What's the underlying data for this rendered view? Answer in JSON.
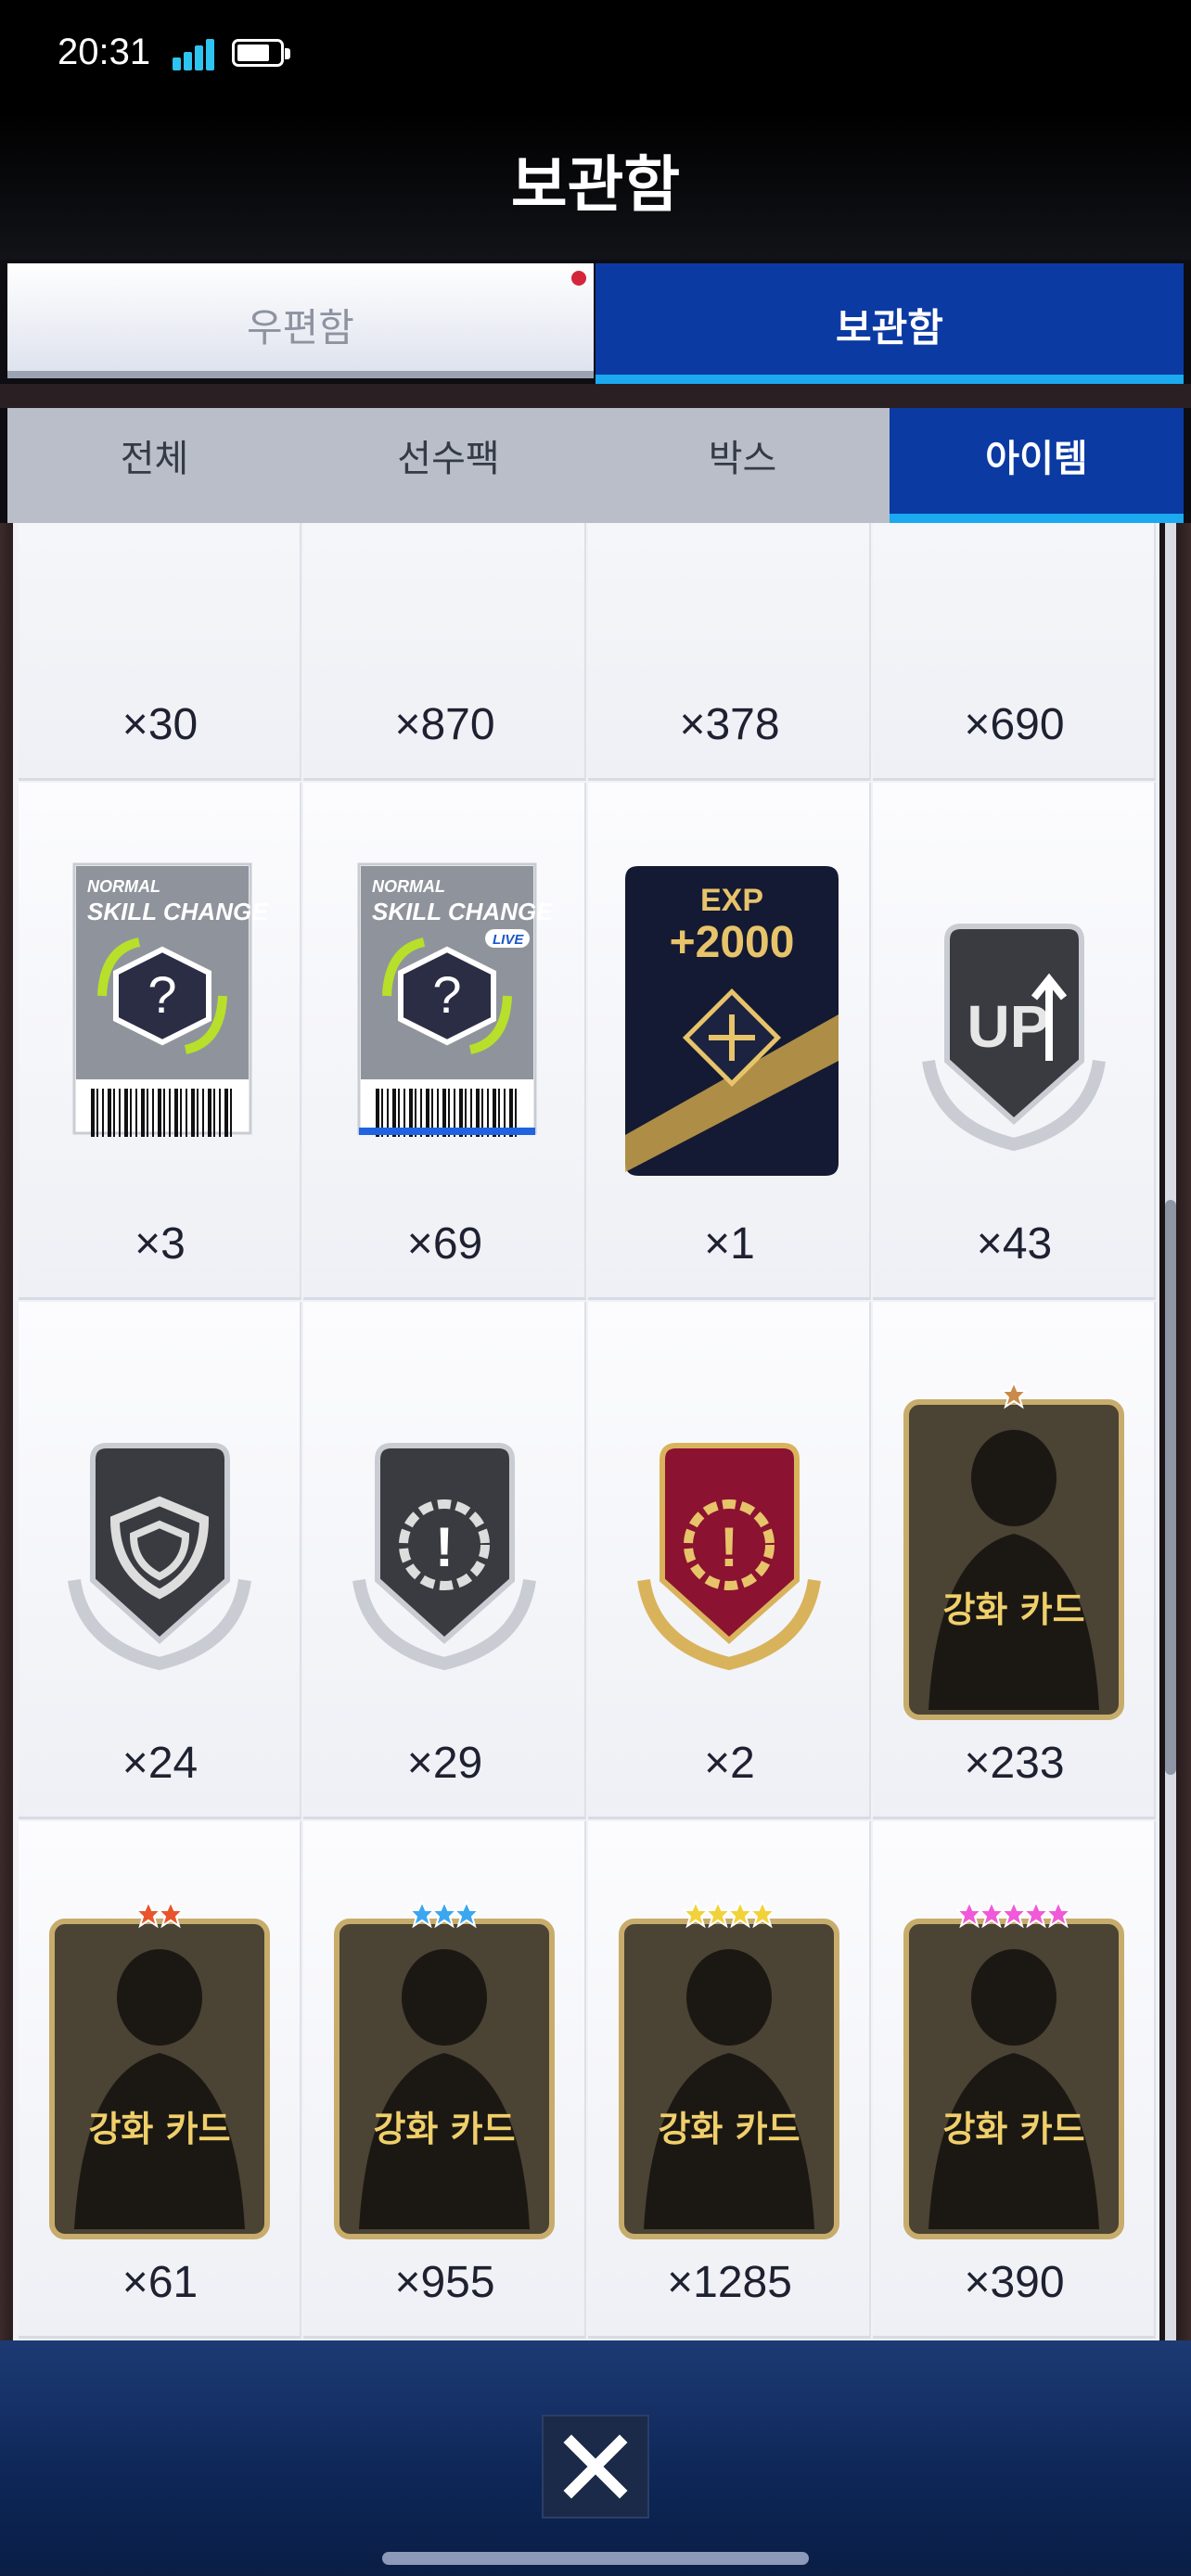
{
  "status": {
    "time": "20:31"
  },
  "header": {
    "title": "보관함"
  },
  "tabs": {
    "mail": "우편함",
    "storage": "보관함"
  },
  "subtabs": [
    "전체",
    "선수팩",
    "박스",
    "아이템"
  ],
  "colors": {
    "accent_blue": "#0b3aa3",
    "accent_cyan": "#1ba9ef",
    "gold": "#e7c36a"
  },
  "items": [
    {
      "icon": "red-gem-pack-icon",
      "count": "×30"
    },
    {
      "icon": "purple-gem-pack-icon",
      "count": "×870"
    },
    {
      "icon": "purple-gem-pack-icon",
      "count": "×378"
    },
    {
      "icon": "purple-gem-pack-icon",
      "count": "×690"
    },
    {
      "icon": "skill-change-ticket-icon",
      "count": "×3",
      "ticket": {
        "line1": "NORMAL",
        "line2": "SKILL CHANGE"
      }
    },
    {
      "icon": "skill-change-live-ticket-icon",
      "count": "×69",
      "ticket": {
        "line1": "NORMAL",
        "line2": "SKILL CHANGE",
        "tag": "LIVE"
      }
    },
    {
      "icon": "exp-card-icon",
      "count": "×1",
      "exp": {
        "label": "EXP",
        "value": "+2000"
      }
    },
    {
      "icon": "up-badge-icon",
      "count": "×43",
      "badge_text": "UP"
    },
    {
      "icon": "shield-badge-icon",
      "count": "×24"
    },
    {
      "icon": "alert-badge-silver-icon",
      "count": "×29"
    },
    {
      "icon": "alert-badge-gold-icon",
      "count": "×2"
    },
    {
      "icon": "enhance-card-1star-icon",
      "count": "×233",
      "card_label": "강화 카드"
    },
    {
      "icon": "enhance-card-2star-icon",
      "count": "×61",
      "card_label": "강화 카드"
    },
    {
      "icon": "enhance-card-3star-icon",
      "count": "×955",
      "card_label": "강화 카드"
    },
    {
      "icon": "enhance-card-4star-icon",
      "count": "×1285",
      "card_label": "강화 카드"
    },
    {
      "icon": "enhance-card-5star-icon",
      "count": "×390",
      "card_label": "강화 카드"
    }
  ],
  "footer": {
    "close_icon": "close-icon"
  }
}
